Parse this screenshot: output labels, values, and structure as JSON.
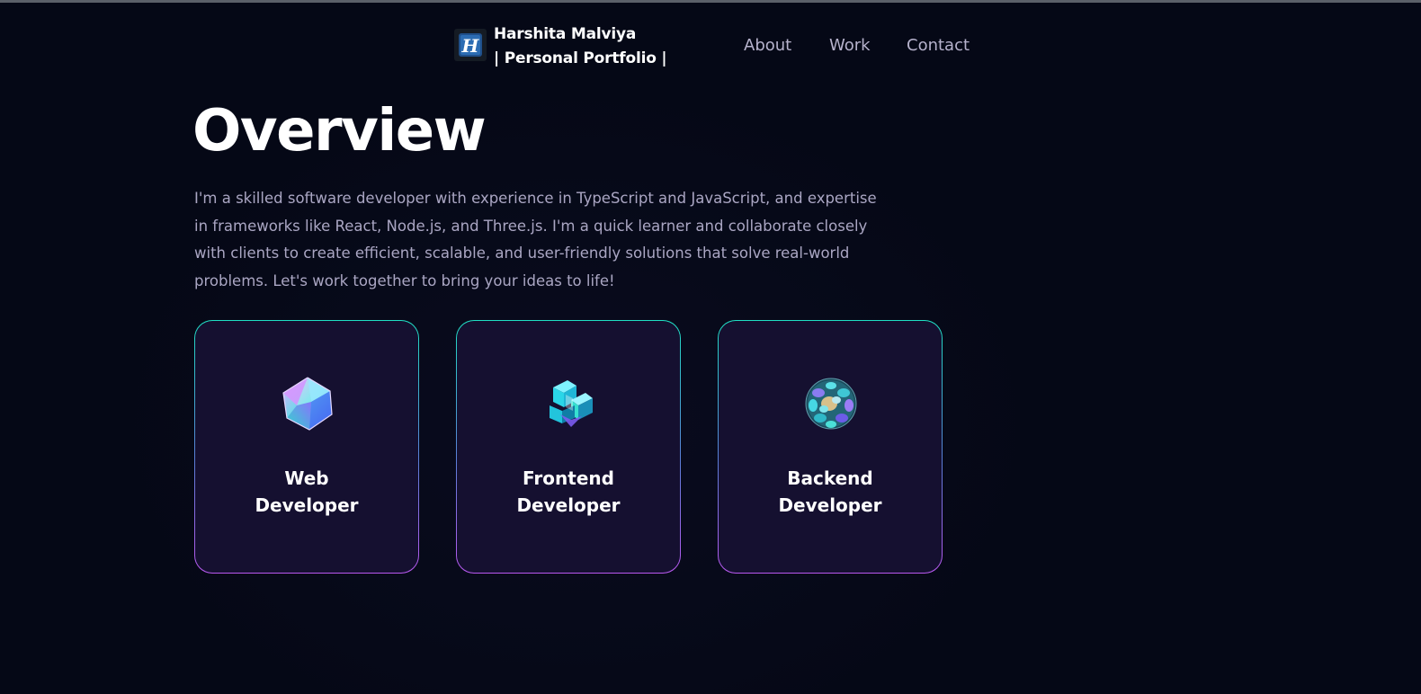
{
  "navbar": {
    "brand_line1": "Harshita Malviya",
    "brand_line2": "| Personal Portfolio |",
    "logo_letter": "H",
    "logo_icon": "h-logo-icon",
    "links": [
      {
        "label": "About"
      },
      {
        "label": "Work"
      },
      {
        "label": "Contact"
      }
    ]
  },
  "overview": {
    "heading": "Overview",
    "intro": "I'm a skilled software developer with experience in TypeScript and JavaScript, and expertise in frameworks like React, Node.js, and Three.js. I'm a quick learner and collaborate closely with clients to create efficient, scalable, and user-friendly solutions that solve real-world problems. Let's work together to bring your ideas to life!"
  },
  "services": [
    {
      "title_line1": "Web",
      "title_line2": "Developer",
      "icon": "web-developer-icon"
    },
    {
      "title_line1": "Frontend",
      "title_line2": "Developer",
      "icon": "frontend-developer-icon"
    },
    {
      "title_line1": "Backend",
      "title_line2": "Developer",
      "icon": "backend-developer-icon"
    }
  ],
  "colors": {
    "background": "#050816",
    "card_background": "#151030",
    "card_border_top": "#1fe0c4",
    "card_border_bottom": "#b958f0",
    "secondary_text": "#aaa6c3",
    "heading_text": "#ffffff"
  }
}
